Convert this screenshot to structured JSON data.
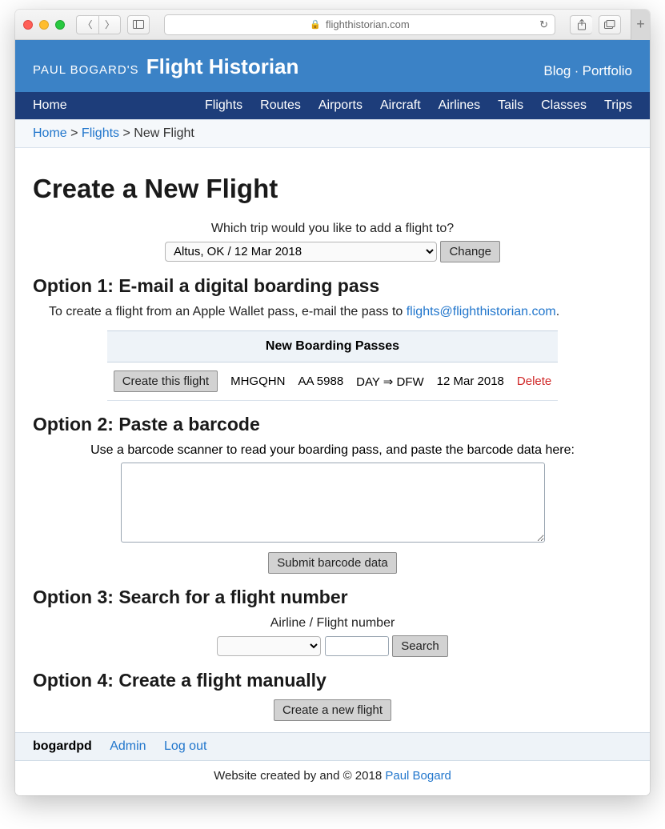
{
  "browser": {
    "domain": "flighthistorian.com"
  },
  "header": {
    "prefix": "PAUL BOGARD'S",
    "title": "Flight Historian",
    "links": {
      "blog": "Blog",
      "sep": "·",
      "portfolio": "Portfolio"
    }
  },
  "nav": {
    "home": "Home",
    "items": [
      "Flights",
      "Routes",
      "Airports",
      "Aircraft",
      "Airlines",
      "Tails",
      "Classes",
      "Trips"
    ]
  },
  "crumbs": {
    "home": "Home",
    "sep": " > ",
    "flights": "Flights",
    "current": "New Flight"
  },
  "page_title": "Create a New Flight",
  "trip": {
    "label": "Which trip would you like to add a flight to?",
    "selected": "Altus, OK / 12 Mar 2018",
    "change_btn": "Change"
  },
  "option1": {
    "heading": "Option 1: E-mail a digital boarding pass",
    "text_prefix": "To create a flight from an Apple Wallet pass, e-mail the pass to ",
    "email": "flights@flighthistorian.com",
    "text_suffix": ".",
    "table_header": "New Boarding Passes",
    "row": {
      "create_btn": "Create this flight",
      "pnr": "MHGQHN",
      "flight": "AA 5988",
      "route": "DAY ⇒ DFW",
      "date": "12 Mar 2018",
      "delete": "Delete"
    }
  },
  "option2": {
    "heading": "Option 2: Paste a barcode",
    "label": "Use a barcode scanner to read your boarding pass, and paste the barcode data here:",
    "submit_btn": "Submit barcode data"
  },
  "option3": {
    "heading": "Option 3: Search for a flight number",
    "label": "Airline / Flight number",
    "search_btn": "Search"
  },
  "option4": {
    "heading": "Option 4: Create a flight manually",
    "create_btn": "Create a new flight"
  },
  "footer": {
    "user": "bogardpd",
    "admin": "Admin",
    "logout": "Log out",
    "copyright_prefix": "Website created by and © 2018 ",
    "author": "Paul Bogard"
  }
}
